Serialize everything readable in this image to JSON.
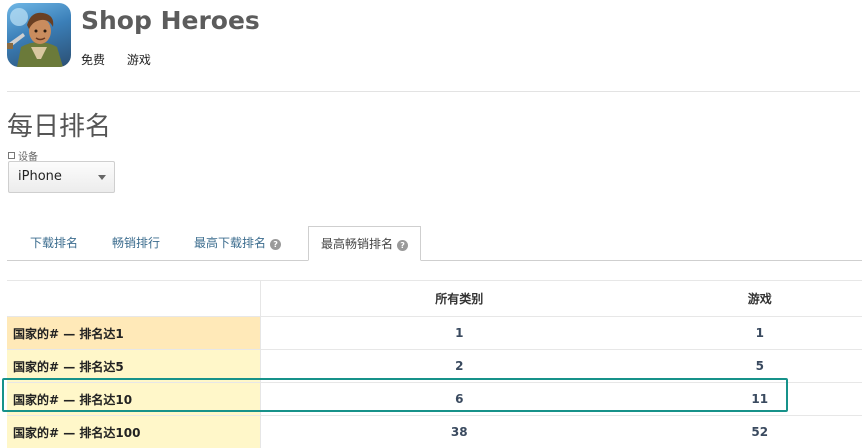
{
  "app": {
    "name": "Shop Heroes",
    "price": "免费",
    "category": "游戏",
    "icon": "app-icon-hero"
  },
  "section": {
    "title": "每日排名",
    "device_label": "设备",
    "device_selected": "iPhone"
  },
  "tabs": [
    {
      "label": "下载排名"
    },
    {
      "label": "畅销排行"
    },
    {
      "label": "最高下载排名",
      "help": "?"
    },
    {
      "label": "最高畅销排名",
      "help": "?",
      "active": true
    }
  ],
  "table": {
    "columns": [
      "所有类别",
      "游戏"
    ],
    "rows": [
      {
        "label": "国家的# — 排名达1",
        "values": [
          "1",
          "1"
        ]
      },
      {
        "label": "国家的# — 排名达5",
        "values": [
          "2",
          "5"
        ]
      },
      {
        "label": "国家的# — 排名达10",
        "values": [
          "6",
          "11"
        ]
      },
      {
        "label": "国家的# — 排名达100",
        "values": [
          "38",
          "52"
        ]
      }
    ]
  },
  "colors": {
    "highlight": "#17928a",
    "tab_link": "#3b6c8e",
    "row_label_bg": "#fff7c9"
  }
}
